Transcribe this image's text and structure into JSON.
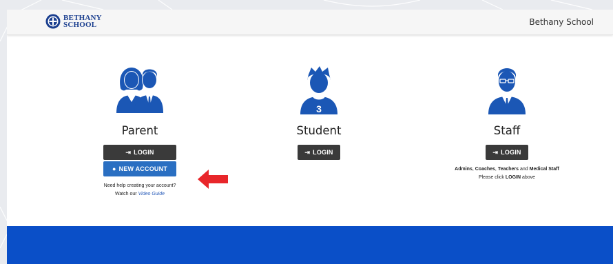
{
  "header": {
    "logo_line1": "BETHANY",
    "logo_line2": "SCHOOL",
    "school_name": "Bethany School"
  },
  "cards": {
    "parent": {
      "title": "Parent",
      "login_label": "LOGIN",
      "new_account_label": "NEW ACCOUNT",
      "help_line1": "Need help creating your account?",
      "help_prefix": "Watch our",
      "help_link": "Video Guide"
    },
    "student": {
      "title": "Student",
      "login_label": "LOGIN",
      "jersey_number": "3"
    },
    "staff": {
      "title": "Staff",
      "login_label": "LOGIN",
      "roles_1": "Admins",
      "roles_sep1": ", ",
      "roles_2": "Coaches",
      "roles_sep2": ", ",
      "roles_3": "Teachers",
      "roles_and": " and ",
      "roles_4": "Medical Staff",
      "note_prefix": "Please click ",
      "note_strong": "LOGIN",
      "note_suffix": " above"
    }
  },
  "colors": {
    "brand_blue": "#1b57b5",
    "footer_blue": "#0a4fc8",
    "arrow_red": "#e8262a",
    "button_dark": "#3a3a3a",
    "button_blue": "#2a6fc2"
  },
  "icons": {
    "login": "login-icon",
    "new_account": "plus-icon",
    "annotation": "red-arrow-icon"
  }
}
